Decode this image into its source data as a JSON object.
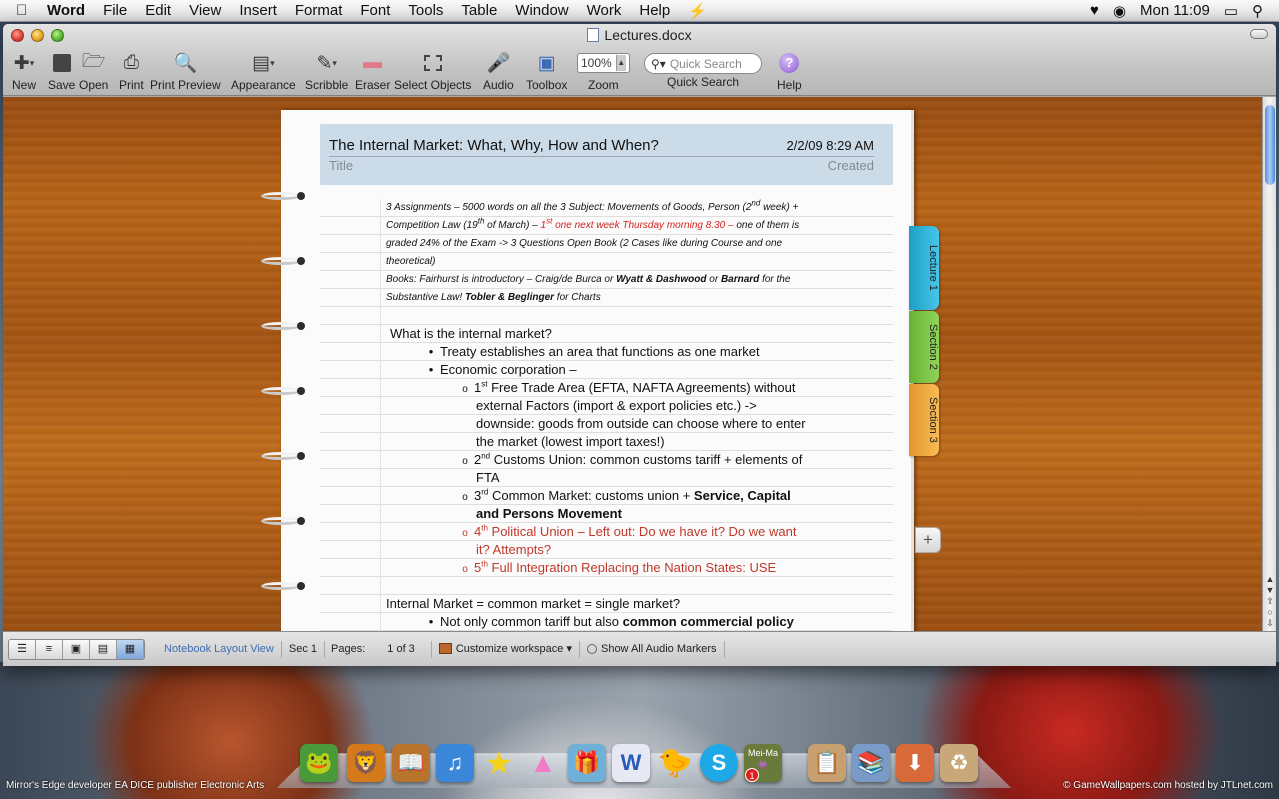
{
  "menubar": {
    "items": [
      {
        "label": "Word",
        "app": true
      },
      {
        "label": "File"
      },
      {
        "label": "Edit"
      },
      {
        "label": "View"
      },
      {
        "label": "Insert"
      },
      {
        "label": "Format"
      },
      {
        "label": "Font"
      },
      {
        "label": "Tools"
      },
      {
        "label": "Table"
      },
      {
        "label": "Window"
      },
      {
        "label": "Work"
      },
      {
        "label": "Help"
      }
    ],
    "clock": "Mon 11:09"
  },
  "window": {
    "title": "Lectures.docx"
  },
  "toolbar": {
    "new": "New",
    "save": "Save",
    "open": "Open",
    "print": "Print",
    "print_preview": "Print Preview",
    "appearance": "Appearance",
    "scribble": "Scribble",
    "eraser": "Eraser",
    "select_objects": "Select Objects",
    "audio": "Audio",
    "toolbox": "Toolbox",
    "zoom": "Zoom",
    "zoom_value": "100%",
    "quick_search": "Quick Search",
    "quick_search_placeholder": "Quick Search",
    "help": "Help"
  },
  "page": {
    "title": "The Internal Market: What, Why, How and When?",
    "date": "2/2/09 8:29 AM",
    "title_label": "Title",
    "created_label": "Created"
  },
  "notes": {
    "l1a": "3 Assignments – 5000 words on all the 3 Subject: Movements of Goods, Person (2",
    "l1sup": "nd",
    "l1b": " week) +",
    "l2a": "Competition Law (19",
    "l2sup": "th",
    "l2b": " of March) – ",
    "l2c": "1",
    "l2csup": "st",
    "l2d": " one next week Thursday morning 8.30 –",
    "l2e": " one of them is",
    "l3": "graded 24% of the Exam -> 3 Questions Open Book (2 Cases like during Course and one",
    "l4": "theoretical)",
    "l5a": "Books: Fairhurst is introductory – Craig/de Burca or ",
    "l5b": "Wyatt & Dashwood",
    "l5c": " or ",
    "l5d": "Barnard",
    "l5e": " for the",
    "l6a": "Substantive Law! ",
    "l6b": "Tobler & Beglinger",
    "l6c": " for Charts",
    "q1": "What is the internal market?",
    "b1": "Treaty establishes an area that functions as one market",
    "b2": "Economic corporation –",
    "s1a": "1",
    "s1sup": "st",
    "s1b": " Free Trade Area (EFTA, NAFTA Agreements) without",
    "s1c": "external Factors (import & export policies etc.) ->",
    "s1d": "downside: goods from outside can choose where to enter",
    "s1e": "the market (lowest import taxes!)",
    "s2a": "2",
    "s2sup": "nd",
    "s2b": " Customs Union: common customs tariff + elements of",
    "s2c": "FTA",
    "s3a": "3",
    "s3sup": "rd",
    "s3b": " Common Market: customs union + ",
    "s3c": "Service, Capital",
    "s3d": "and Persons Movement",
    "s4a": "4",
    "s4sup": "th",
    "s4b": " Political Union – Left out: Do we have it? Do we want",
    "s4c": "it? Attempts?",
    "s5a": "5",
    "s5sup": "th",
    "s5b": " Full Integration Replacing the Nation States: USE",
    "q2": "Internal Market = common market = single market?",
    "b3a": "Not only common tariff but also ",
    "b3b": "common commercial policy"
  },
  "tabs": [
    {
      "label": "Lecture 1",
      "color": "#2ab3d8"
    },
    {
      "label": "Section 2",
      "color": "#7cc443"
    },
    {
      "label": "Section 3",
      "color": "#f0a83a"
    }
  ],
  "status": {
    "view_name": "Notebook Layout View",
    "section": "Sec",
    "section_num": "1",
    "pages_label": "Pages:",
    "pages_value": "1 of 3",
    "customize": "Customize workspace",
    "audio_markers": "Show All Audio Markers"
  },
  "dock": {
    "badge": "1",
    "meima": "Mei-Ma"
  },
  "credits": {
    "left": "Mirror's Edge developer EA DICE publisher Electronic Arts",
    "right": "© GameWallpapers.com hosted by JTLnet.com"
  }
}
